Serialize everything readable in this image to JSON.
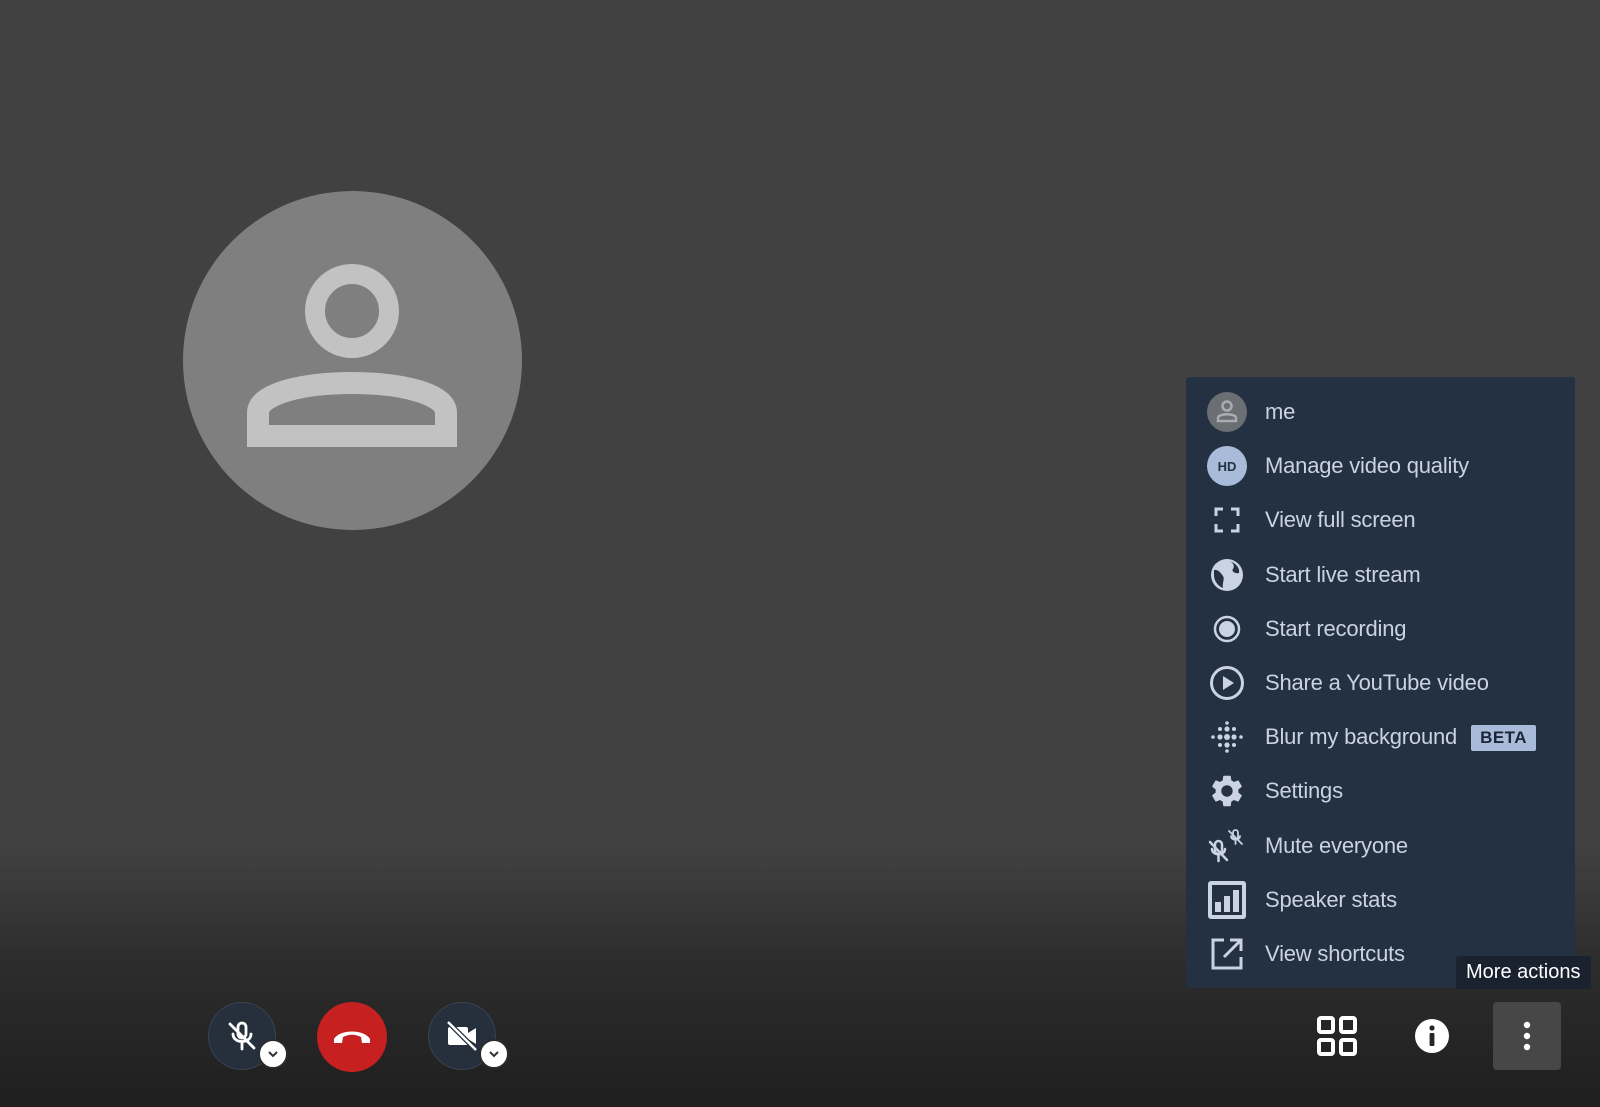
{
  "menu": {
    "items": [
      {
        "label": "me",
        "icon": "user-avatar-icon"
      },
      {
        "label": "Manage video quality",
        "icon": "hd-icon",
        "icon_text": "HD"
      },
      {
        "label": "View full screen",
        "icon": "fullscreen-icon"
      },
      {
        "label": "Start live stream",
        "icon": "globe-icon"
      },
      {
        "label": "Start recording",
        "icon": "record-icon"
      },
      {
        "label": "Share a YouTube video",
        "icon": "play-circle-icon"
      },
      {
        "label": "Blur my background",
        "icon": "blur-icon",
        "badge": "BETA"
      },
      {
        "label": "Settings",
        "icon": "gear-icon"
      },
      {
        "label": "Mute everyone",
        "icon": "mute-everyone-icon"
      },
      {
        "label": "Speaker stats",
        "icon": "bar-chart-icon"
      },
      {
        "label": "View shortcuts",
        "icon": "external-link-icon"
      }
    ]
  },
  "tooltip": {
    "text": "More actions"
  },
  "toolbar": {
    "mic": {
      "state": "muted",
      "icon": "mic-off-icon"
    },
    "hangup": {
      "icon": "phone-hangup-icon"
    },
    "camera": {
      "state": "off",
      "icon": "camera-off-icon"
    },
    "tile_view": {
      "icon": "tile-grid-icon"
    },
    "info": {
      "icon": "info-icon"
    },
    "more": {
      "icon": "more-vertical-icon"
    }
  },
  "colors": {
    "background": "#414141",
    "menu_bg": "#243142",
    "menu_text": "#c9d3e1",
    "hangup": "#c62020",
    "avatar": "#7f7f7f",
    "beta_badge": "#a8bcd9"
  }
}
